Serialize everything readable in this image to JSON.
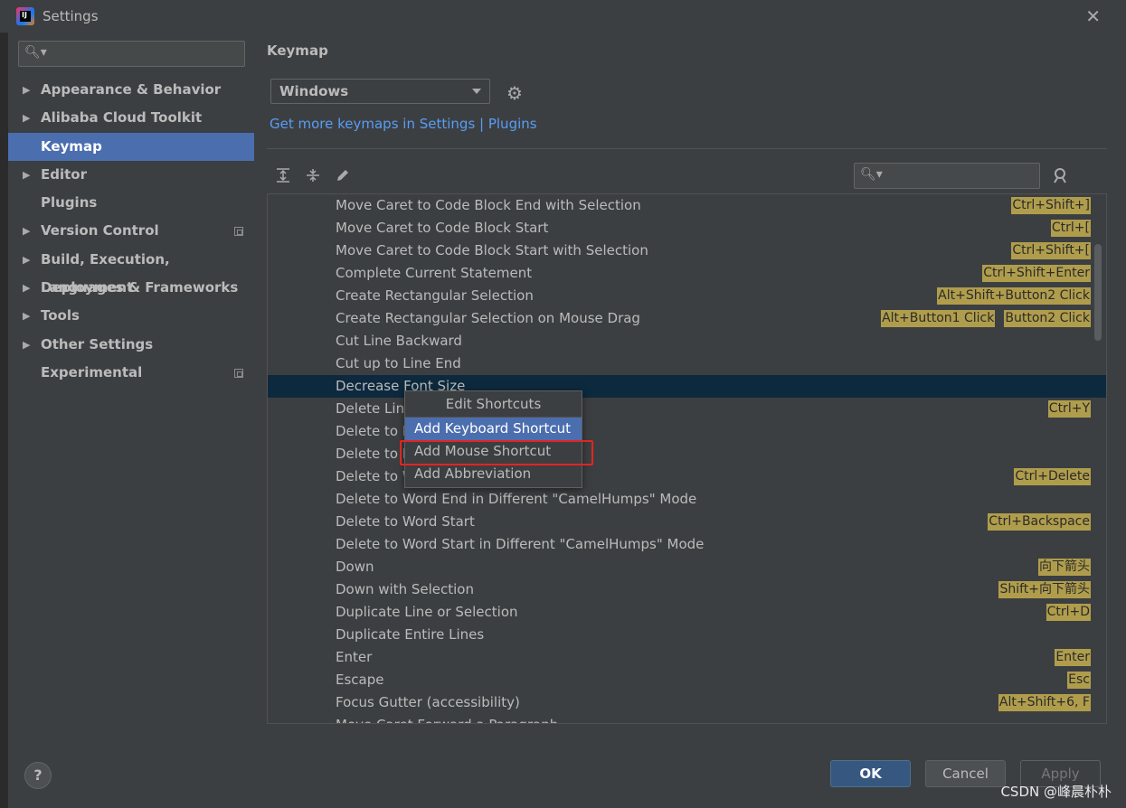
{
  "window": {
    "title": "Settings",
    "close_glyph": "✕"
  },
  "sidebar": {
    "items": [
      {
        "label": "Appearance & Behavior",
        "expandable": true,
        "selected": false,
        "project": false
      },
      {
        "label": "Alibaba Cloud Toolkit",
        "expandable": true,
        "selected": false,
        "project": false
      },
      {
        "label": "Keymap",
        "expandable": false,
        "selected": true,
        "project": false
      },
      {
        "label": "Editor",
        "expandable": true,
        "selected": false,
        "project": false
      },
      {
        "label": "Plugins",
        "expandable": false,
        "selected": false,
        "project": false
      },
      {
        "label": "Version Control",
        "expandable": true,
        "selected": false,
        "project": true
      },
      {
        "label": "Build, Execution, Deployment",
        "expandable": true,
        "selected": false,
        "project": false
      },
      {
        "label": "Languages & Frameworks",
        "expandable": true,
        "selected": false,
        "project": false
      },
      {
        "label": "Tools",
        "expandable": true,
        "selected": false,
        "project": false
      },
      {
        "label": "Other Settings",
        "expandable": true,
        "selected": false,
        "project": false
      },
      {
        "label": "Experimental",
        "expandable": false,
        "selected": false,
        "project": true
      }
    ]
  },
  "main": {
    "heading": "Keymap",
    "keymap_value": "Windows",
    "link": "Get more keymaps in Settings | Plugins",
    "actions": [
      {
        "name": "Move Caret to Code Block End with Selection",
        "shortcuts": [
          "Ctrl+Shift+]"
        ]
      },
      {
        "name": "Move Caret to Code Block Start",
        "shortcuts": [
          "Ctrl+["
        ]
      },
      {
        "name": "Move Caret to Code Block Start with Selection",
        "shortcuts": [
          "Ctrl+Shift+["
        ]
      },
      {
        "name": "Complete Current Statement",
        "shortcuts": [
          "Ctrl+Shift+Enter"
        ]
      },
      {
        "name": "Create Rectangular Selection",
        "shortcuts": [
          "Alt+Shift+Button2 Click"
        ]
      },
      {
        "name": "Create Rectangular Selection on Mouse Drag",
        "shortcuts": [
          "Alt+Button1 Click",
          "Button2 Click"
        ]
      },
      {
        "name": "Cut Line Backward",
        "shortcuts": []
      },
      {
        "name": "Cut up to Line End",
        "shortcuts": []
      },
      {
        "name": "Decrease Font Size",
        "shortcuts": [],
        "selected": true
      },
      {
        "name": "Delete Line",
        "shortcuts": [
          "Ctrl+Y"
        ]
      },
      {
        "name": "Delete to L",
        "shortcuts": []
      },
      {
        "name": "Delete to L",
        "shortcuts": []
      },
      {
        "name": "Delete to W",
        "shortcuts": [
          "Ctrl+Delete"
        ]
      },
      {
        "name": "Delete to Word End in Different \"CamelHumps\" Mode",
        "shortcuts": []
      },
      {
        "name": "Delete to Word Start",
        "shortcuts": [
          "Ctrl+Backspace"
        ]
      },
      {
        "name": "Delete to Word Start in Different \"CamelHumps\" Mode",
        "shortcuts": []
      },
      {
        "name": "Down",
        "shortcuts": [
          "向下箭头"
        ]
      },
      {
        "name": "Down with Selection",
        "shortcuts": [
          "Shift+向下箭头"
        ]
      },
      {
        "name": "Duplicate Line or Selection",
        "shortcuts": [
          "Ctrl+D"
        ]
      },
      {
        "name": "Duplicate Entire Lines",
        "shortcuts": []
      },
      {
        "name": "Enter",
        "shortcuts": [
          "Enter"
        ]
      },
      {
        "name": "Escape",
        "shortcuts": [
          "Esc"
        ]
      },
      {
        "name": "Focus Gutter (accessibility)",
        "shortcuts": [
          "Alt+Shift+6, F"
        ]
      },
      {
        "name": "Move Caret Forward a Paragraph",
        "shortcuts": []
      }
    ]
  },
  "popup": {
    "title": "Edit Shortcuts",
    "items": [
      {
        "label": "Add Keyboard Shortcut",
        "highlighted": true
      },
      {
        "label": "Add Mouse Shortcut",
        "highlighted": false
      },
      {
        "label": "Add Abbreviation",
        "highlighted": false
      }
    ]
  },
  "footer": {
    "help": "?",
    "ok": "OK",
    "cancel": "Cancel",
    "apply": "Apply",
    "watermark": "CSDN @峰晨朴朴"
  },
  "icons": {
    "search": "search-icon",
    "gear": "gear-icon",
    "expand_all": "expand-all-icon",
    "collapse_all": "collapse-all-icon",
    "edit": "pencil-icon",
    "find_shortcut": "find-shortcut-icon"
  },
  "colors": {
    "selection": "#4b6eaf",
    "tree_selection": "#0d293e",
    "shortcut_bg": "#b09d4c",
    "link": "#589df6",
    "highlight_box": "#e32424"
  }
}
